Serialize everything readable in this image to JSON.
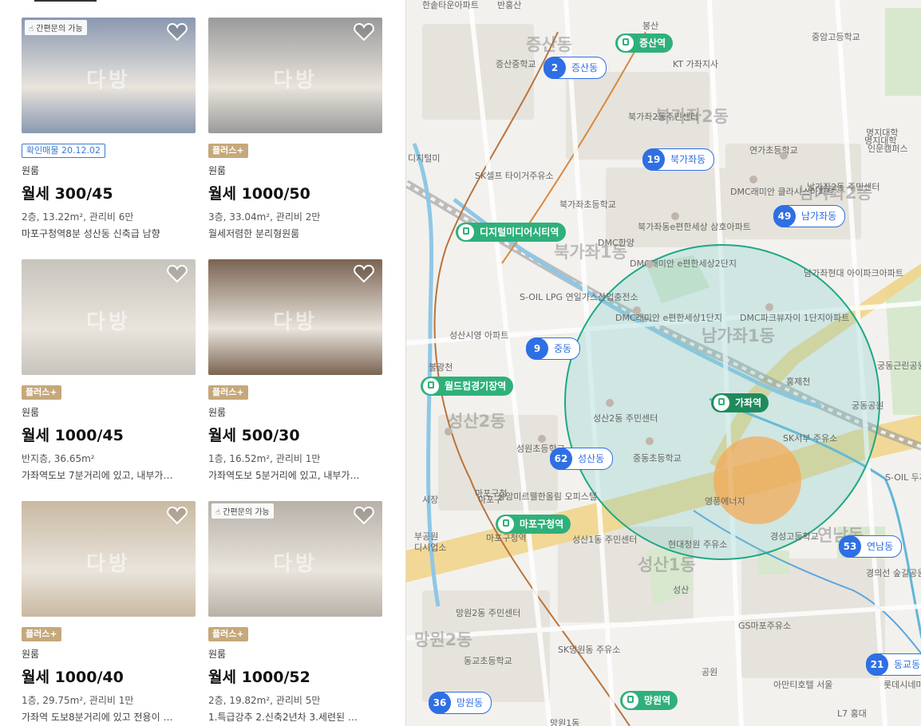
{
  "listings": [
    {
      "note": "간편문의 가능",
      "badge": "확인매물 20.12.02",
      "badge_type": "confirmed",
      "type": "원룸",
      "price": "월세 300/45",
      "info": "2층, 13.22m², 관리비 6만",
      "desc": "마포구청역8분 성산동 신축급 남향",
      "photo_color": "#8a98b0"
    },
    {
      "note": "",
      "badge": "플러스+",
      "badge_type": "plus",
      "type": "원룸",
      "price": "월세 1000/50",
      "info": "3층, 33.04m², 관리비 2만",
      "desc": "월세저렴한 분리형원룸",
      "photo_color": "#9a9a9a"
    },
    {
      "note": "",
      "badge": "플러스+",
      "badge_type": "plus",
      "type": "원룸",
      "price": "월세 1000/45",
      "info": "반지층, 36.65m²",
      "desc": "가좌역도보 7분거리에 있고, 내부가…",
      "photo_color": "#c7c4bd"
    },
    {
      "note": "",
      "badge": "플러스+",
      "badge_type": "plus",
      "type": "원룸",
      "price": "월세 500/30",
      "info": "1층, 16.52m², 관리비 1만",
      "desc": "가좌역도보 5분거리에 있고, 내부가…",
      "photo_color": "#7a6452"
    },
    {
      "note": "",
      "badge": "플러스+",
      "badge_type": "plus",
      "type": "원룸",
      "price": "월세 1000/40",
      "info": "1층, 29.75m², 관리비 1만",
      "desc": "가좌역 도보8분거리에 있고 전용이 …",
      "photo_color": "#c9b9a2"
    },
    {
      "note": "간편문의 가능",
      "badge": "플러스+",
      "badge_type": "plus",
      "type": "원룸",
      "price": "월세 1000/52",
      "info": "2층, 19.82m², 관리비 5만",
      "desc": "1.특급강추 2.신축2년차 3.세련된 …",
      "photo_color": "#b7b1a8"
    }
  ],
  "watermark": "다방",
  "map": {
    "stations": [
      {
        "name": "증산역",
        "sel": false
      },
      {
        "name": "디지털미디어시티역",
        "sel": false
      },
      {
        "name": "월드컵경기장역",
        "sel": false
      },
      {
        "name": "가좌역",
        "sel": true
      },
      {
        "name": "마포구청역",
        "sel": false
      },
      {
        "name": "망원역",
        "sel": false
      }
    ],
    "clusters": [
      {
        "count": "2",
        "name": "증산동"
      },
      {
        "count": "19",
        "name": "북가좌동"
      },
      {
        "count": "49",
        "name": "남가좌동"
      },
      {
        "count": "9",
        "name": "중동"
      },
      {
        "count": "62",
        "name": "성산동"
      },
      {
        "count": "53",
        "name": "연남동"
      },
      {
        "count": "21",
        "name": "동교동"
      },
      {
        "count": "36",
        "name": "망원동"
      }
    ],
    "districts": [
      "증산동",
      "북가좌2동",
      "남가좌2동",
      "북가좌1동",
      "남가좌1동",
      "성산2동",
      "성산1동",
      "망원2동",
      "연남동"
    ],
    "labels": [
      "한솥타운아파트",
      "반홍산",
      "봉산",
      "증산중학교",
      "KT 가좌지사",
      "중암고등학교",
      "북가좌2동주민센터",
      "연가초등학교",
      "명지대학",
      "인문캠퍼스",
      "명지대학",
      "SK셀프 타이거주유소",
      "북가좌초등학교",
      "DMC래미안 클라시스아파트",
      "남가좌2동 주민센터",
      "디지털미",
      "북가좌동e편한세상 삼호아파트",
      "DMC한양",
      "DMC래미안 e편한세상2단지",
      "남가좌현대 아이파크아파트",
      "S-OIL LPG 연일가스산업충전소",
      "DMC래미안 e편한세상1단지",
      "DMC파크뷰자이 1단지아파트",
      "성산시영 아파트",
      "불광천",
      "홍제천",
      "궁동근린공원",
      "궁동공원",
      "성산2동 주민센터",
      "성원초등학교",
      "중동초등학교",
      "SK서부 주유소",
      "마포구청",
      "상암미르웰한올림 오피스텔",
      "영풍에너지",
      "S-OIL 두꺼비주유소",
      "성산1동 주민센터",
      "현대청원 주유소",
      "경성고등학교",
      "경의선 숲길공원",
      "마포구청역",
      "성산",
      "망원2동 주민센터",
      "동교초등학교",
      "SK망원동 주유소",
      "공원",
      "GS마포주유소",
      "아만티호텔 서울",
      "롯데시네마 홍대입구",
      "L7 홍대",
      "망원1동",
      "시장",
      "부공원",
      "디시업소",
      "마포구"
    ]
  }
}
